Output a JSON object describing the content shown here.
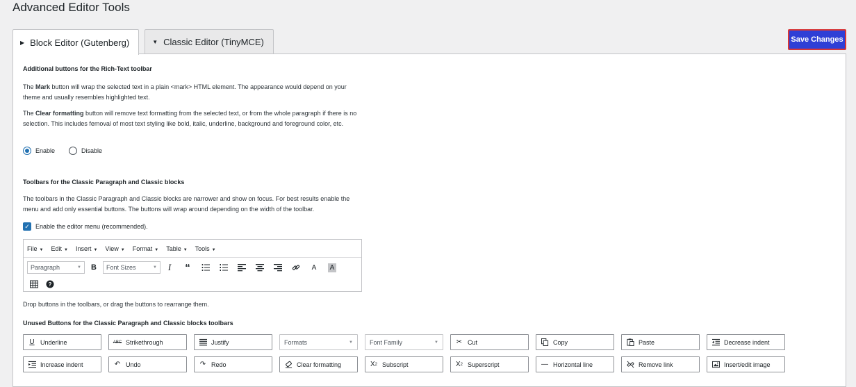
{
  "page": {
    "title": "Advanced Editor Tools"
  },
  "tabs": [
    {
      "label": "Block Editor (Gutenberg)",
      "active": true
    },
    {
      "label": "Classic Editor (TinyMCE)",
      "active": false
    }
  ],
  "save_label": "Save Changes",
  "colors": {
    "save_bg": "#2f3fd6",
    "save_border": "#d63638",
    "accent": "#2271b1"
  },
  "rich_text": {
    "heading": "Additional buttons for the Rich-Text toolbar",
    "mark_bold": "Mark",
    "mark_pre": "The ",
    "mark_rest": " button will wrap the selected text in a plain <mark> HTML element. The appearance would depend on your theme and usually resembles highlighted text.",
    "clear_pre": "The ",
    "clear_bold": "Clear formatting",
    "clear_rest": " button will remove text formatting from the selected text, or from the whole paragraph if there is no selection. This includes femoval of most text styling like bold, italic, underline, background and foreground color, etc.",
    "enable_label": "Enable",
    "disable_label": "Disable",
    "selected": "Enable"
  },
  "classic_toolbars": {
    "heading": "Toolbars for the Classic Paragraph and Classic blocks",
    "description": "The toolbars in the Classic Paragraph and Classic blocks are narrower and show on focus. For best results enable the menu and add only essential buttons. The buttons will wrap around depending on the width of the toolbar.",
    "menu_checkbox_label": "Enable the editor menu (recommended).",
    "menu_checked": true
  },
  "editor": {
    "menus": [
      "File",
      "Edit",
      "Insert",
      "View",
      "Format",
      "Table",
      "Tools"
    ],
    "paragraph_select": "Paragraph",
    "font_size_select": "Font Sizes",
    "tool_icons": [
      "bold-icon",
      "italic-icon",
      "blockquote-icon",
      "bullet-list-icon",
      "numbered-list-icon",
      "align-left-icon",
      "align-center-icon",
      "align-right-icon",
      "link-icon",
      "text-color-icon",
      "background-color-icon",
      "table-icon",
      "help-icon"
    ]
  },
  "drop_hint": "Drop buttons in the toolbars, or drag the buttons to rearrange them.",
  "unused": {
    "heading": "Unused Buttons for the Classic Paragraph and Classic blocks toolbars",
    "row1": [
      {
        "label": "Underline",
        "icon": "underline-icon"
      },
      {
        "label": "Strikethrough",
        "icon": "strikethrough-icon"
      },
      {
        "label": "Justify",
        "icon": "justify-icon"
      },
      {
        "label": "Formats",
        "icon": "dropdown"
      },
      {
        "label": "Font Family",
        "icon": "dropdown"
      },
      {
        "label": "Cut",
        "icon": "scissors-icon"
      },
      {
        "label": "Copy",
        "icon": "copy-icon"
      },
      {
        "label": "Paste",
        "icon": "paste-icon"
      },
      {
        "label": "Decrease indent",
        "icon": "outdent-icon"
      }
    ],
    "row2": [
      {
        "label": "Increase indent",
        "icon": "indent-icon"
      },
      {
        "label": "Undo",
        "icon": "undo-icon"
      },
      {
        "label": "Redo",
        "icon": "redo-icon"
      },
      {
        "label": "Clear formatting",
        "icon": "eraser-icon"
      },
      {
        "label": "Subscript",
        "icon": "subscript-icon"
      },
      {
        "label": "Superscript",
        "icon": "superscript-icon"
      },
      {
        "label": "Horizontal line",
        "icon": "horizontal-line-icon"
      },
      {
        "label": "Remove link",
        "icon": "unlink-icon"
      },
      {
        "label": "Insert/edit image",
        "icon": "image-icon"
      }
    ]
  }
}
